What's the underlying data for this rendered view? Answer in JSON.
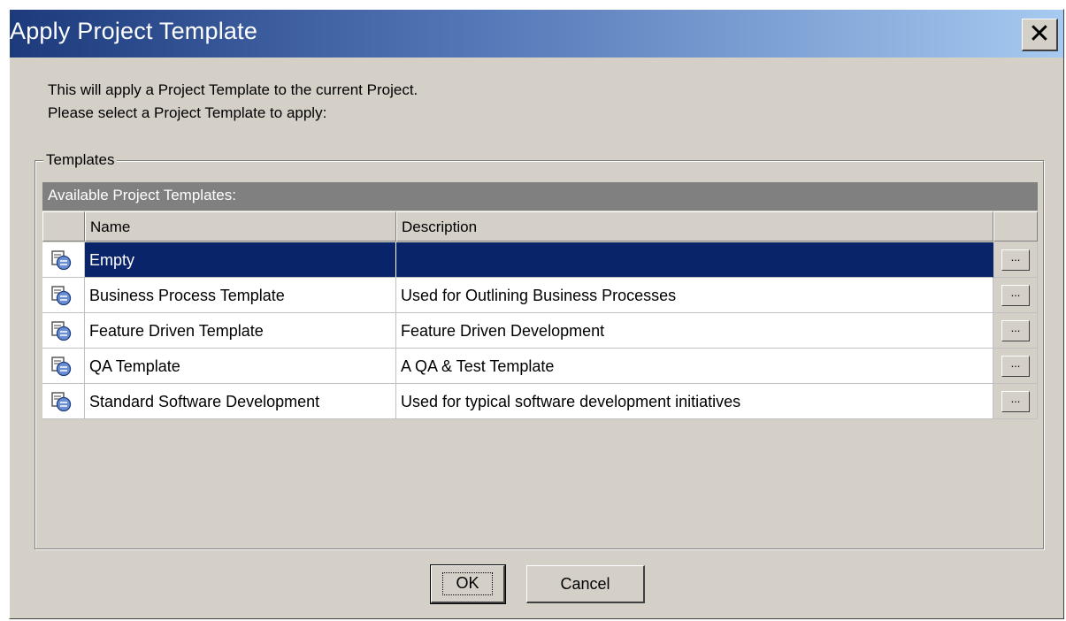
{
  "dialog": {
    "title": "Apply Project Template",
    "close_label": "✕",
    "intro_line1": "This will apply a Project Template to the current Project.",
    "intro_line2": "Please select a Project Template to apply:"
  },
  "templates_group": {
    "legend": "Templates",
    "caption": "Available Project Templates:",
    "columns": [
      "",
      "Name",
      "Description",
      ""
    ],
    "rows": [
      {
        "name": "Empty",
        "description": "",
        "selected": true
      },
      {
        "name": "Business Process Template",
        "description": "Used for Outlining Business Processes",
        "selected": false
      },
      {
        "name": "Feature Driven Template",
        "description": "Feature Driven Development",
        "selected": false
      },
      {
        "name": "QA Template",
        "description": "A QA & Test Template",
        "selected": false
      },
      {
        "name": "Standard Software Development",
        "description": "Used for typical software development initiatives",
        "selected": false
      }
    ],
    "row_button_label": "...",
    "row_icon": "template-icon"
  },
  "buttons": {
    "ok": "OK",
    "cancel": "Cancel"
  },
  "colors": {
    "selection": "#0a246a",
    "dialog_bg": "#d4d0c8",
    "caption_bg": "#808080"
  }
}
